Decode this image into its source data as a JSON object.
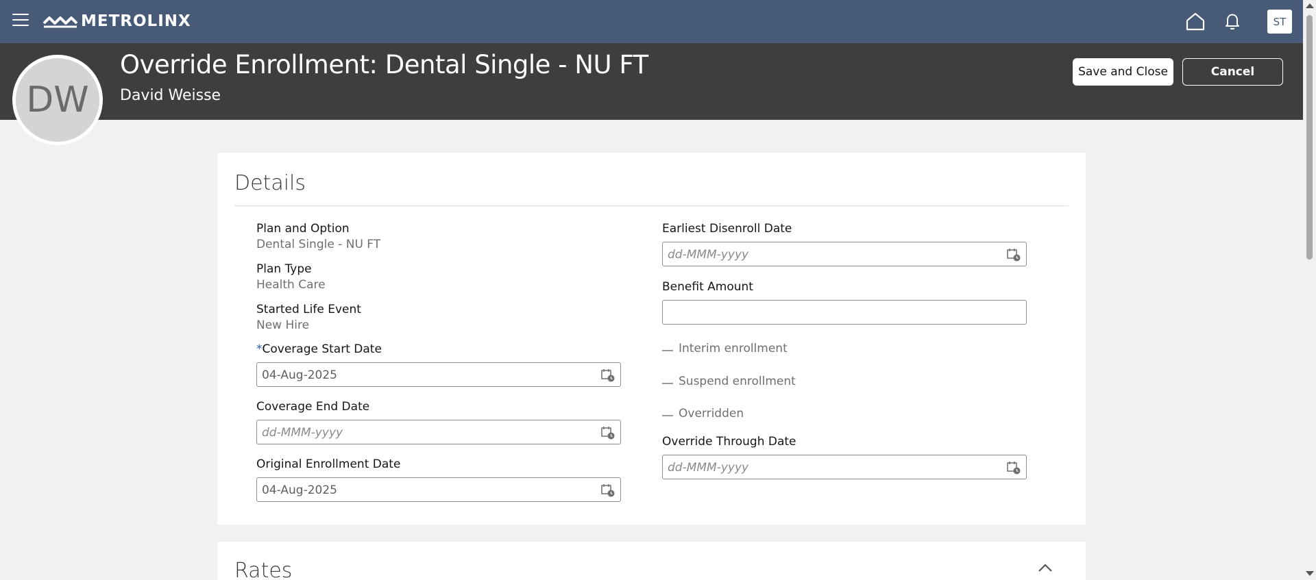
{
  "topbar": {
    "logo_text": "METROLINX",
    "user_initials": "ST"
  },
  "header": {
    "avatar_initials": "DW",
    "title": "Override Enrollment: Dental Single - NU FT",
    "person_name": "David Weisse",
    "save_label": "Save and Close",
    "cancel_label": "Cancel"
  },
  "details": {
    "section_title": "Details",
    "plan_option_label": "Plan and Option",
    "plan_option_value": "Dental Single - NU FT",
    "plan_type_label": "Plan Type",
    "plan_type_value": "Health Care",
    "life_event_label": "Started Life Event",
    "life_event_value": "New Hire",
    "required_marker": "*",
    "coverage_start_label": "Coverage Start Date",
    "coverage_start_value": "04-Aug-2025",
    "coverage_end_label": "Coverage End Date",
    "coverage_end_placeholder": "dd-MMM-yyyy",
    "original_enroll_label": "Original Enrollment Date",
    "original_enroll_value": "04-Aug-2025",
    "earliest_disenroll_label": "Earliest Disenroll Date",
    "earliest_disenroll_placeholder": "dd-MMM-yyyy",
    "benefit_amount_label": "Benefit Amount",
    "benefit_amount_value": "",
    "interim_label": "Interim enrollment",
    "suspend_label": "Suspend enrollment",
    "overridden_label": "Overridden",
    "override_through_label": "Override Through Date",
    "override_through_placeholder": "dd-MMM-yyyy"
  },
  "rates": {
    "section_title": "Rates"
  },
  "colors": {
    "topbar": "#475a77",
    "header": "#3e3e3e",
    "background": "#f1f1f1",
    "required": "#1f5fa8"
  }
}
